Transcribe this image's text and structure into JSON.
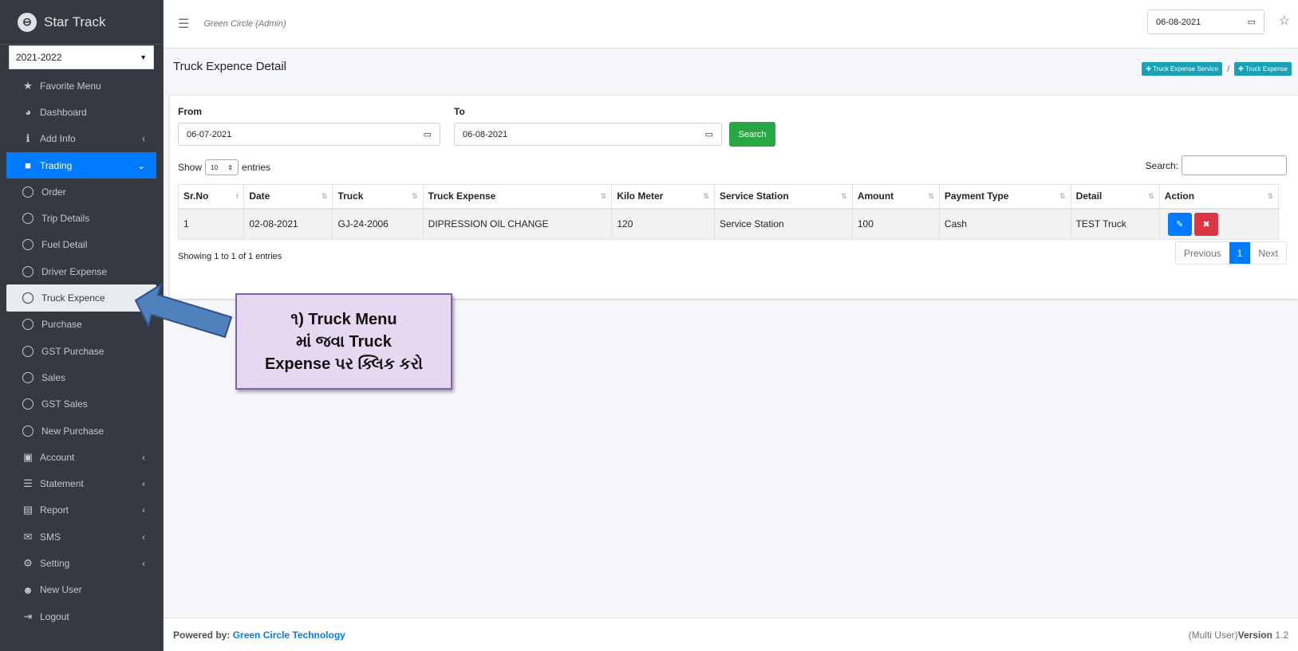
{
  "brand": {
    "name": "Star Track"
  },
  "year_select": {
    "value": "2021-2022"
  },
  "sidebar": {
    "items": [
      {
        "label": "Favorite Menu",
        "icon": "star-icon",
        "glyph": "★"
      },
      {
        "label": "Dashboard",
        "icon": "dashboard-icon",
        "glyph": "◕"
      },
      {
        "label": "Add Info",
        "icon": "info-icon",
        "glyph": "ℹ",
        "arrow": "‹"
      },
      {
        "label": "Trading",
        "icon": "briefcase-icon",
        "glyph": "■",
        "arrow": "⌄"
      },
      {
        "label": "Order",
        "icon": "circle-icon"
      },
      {
        "label": "Trip Details",
        "icon": "circle-icon"
      },
      {
        "label": "Fuel Detail",
        "icon": "circle-icon"
      },
      {
        "label": "Driver Expense",
        "icon": "circle-icon"
      },
      {
        "label": "Truck Expence",
        "icon": "circle-icon"
      },
      {
        "label": "Purchase",
        "icon": "circle-icon"
      },
      {
        "label": "GST Purchase",
        "icon": "circle-icon"
      },
      {
        "label": "Sales",
        "icon": "circle-icon"
      },
      {
        "label": "GST Sales",
        "icon": "circle-icon"
      },
      {
        "label": "New Purchase",
        "icon": "circle-icon"
      },
      {
        "label": "Account",
        "icon": "money-icon",
        "glyph": "▣",
        "arrow": "‹"
      },
      {
        "label": "Statement",
        "icon": "list-icon",
        "glyph": "☰",
        "arrow": "‹"
      },
      {
        "label": "Report",
        "icon": "file-icon",
        "glyph": "▤",
        "arrow": "‹"
      },
      {
        "label": "SMS",
        "icon": "envelope-icon",
        "glyph": "✉",
        "arrow": "‹"
      },
      {
        "label": "Setting",
        "icon": "cogs-icon",
        "glyph": "⚙",
        "arrow": "‹"
      },
      {
        "label": "New User",
        "icon": "user-icon",
        "glyph": "☻"
      },
      {
        "label": "Logout",
        "icon": "logout-icon",
        "glyph": "⇥"
      }
    ]
  },
  "header": {
    "company": "Green Circle (Admin)",
    "date": "06-08-2021"
  },
  "page": {
    "title": "Truck Expence Detail",
    "breadcrumb": [
      "Truck Expense Service",
      "Truck Expense"
    ]
  },
  "filter": {
    "from_label": "From",
    "from_value": "06-07-2021",
    "to_label": "To",
    "to_value": "06-08-2021",
    "search_button": "Search"
  },
  "datatable": {
    "show_label": "Show",
    "entries_value": "10",
    "entries_label": "entries",
    "search_label": "Search:",
    "columns": [
      "Sr.No",
      "Date",
      "Truck",
      "Truck Expense",
      "Kilo Meter",
      "Service Station",
      "Amount",
      "Payment Type",
      "Detail",
      "Action"
    ],
    "rows": [
      [
        "1",
        "02-08-2021",
        "GJ-24-2006",
        "DIPRESSION OIL CHANGE",
        "120",
        "Service Station",
        "100",
        "Cash",
        "TEST Truck"
      ]
    ],
    "info": "Showing 1 to 1 of 1 entries",
    "pagination": {
      "previous": "Previous",
      "current": "1",
      "next": "Next"
    }
  },
  "footer": {
    "powered_label": "Powered by:",
    "powered_link": "Green Circle Technology",
    "version_prefix": "(Multi User)",
    "version_label": "Version",
    "version_number": "1.2"
  },
  "annotation": {
    "text": "૧) Truck Menu\nમાં જવા Truck\nExpense પર ક્લિક કરો"
  },
  "colors": {
    "sidebar": "#343a40",
    "primary": "#007bff",
    "success": "#28a745",
    "info": "#17a2b8",
    "danger": "#dc3545",
    "note_bg": "#e5d8f0",
    "note_border": "#8064a2",
    "arrow": "#4f81bd"
  }
}
